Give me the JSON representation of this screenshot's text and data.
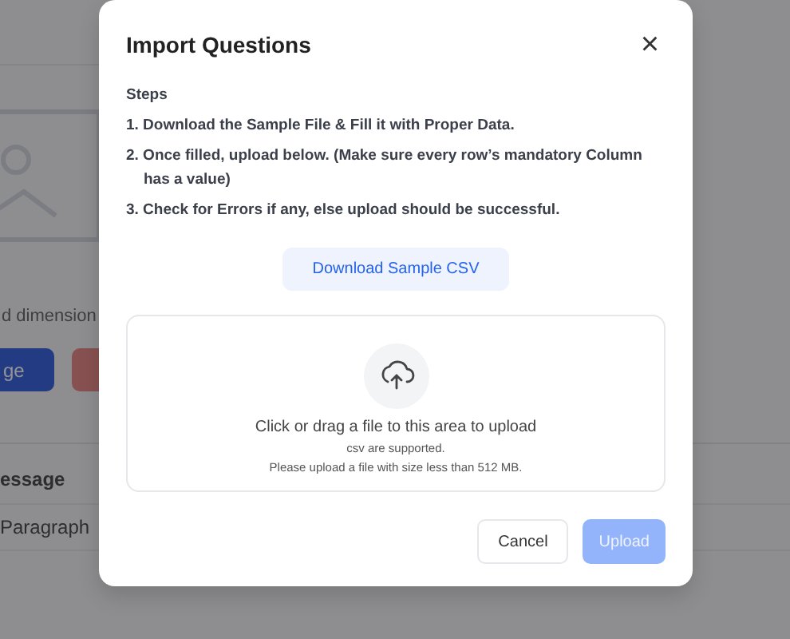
{
  "background": {
    "caption": "d dimension",
    "primary_button": "ge",
    "table": {
      "column_1": "essage",
      "rows": [
        "Paragraph"
      ]
    }
  },
  "dialog": {
    "title": "Import Questions",
    "close": "×",
    "steps_heading": "Steps",
    "steps": [
      "1. Download the Sample File & Fill it with Proper Data.",
      "2. Once filled, upload below. (Make sure every row’s mandatory Column has a value)",
      "3. Check for Errors if any, else upload should be successful."
    ],
    "download_button": "Download Sample CSV",
    "dropzone": {
      "title": "Click or drag a file to this area to upload",
      "hint": "csv are supported.",
      "limit": "Please upload a file with size less than 512 MB."
    },
    "buttons": [
      {
        "label": "Cancel",
        "kind": "secondary",
        "disabled": false
      },
      {
        "label": "Upload",
        "kind": "primary",
        "disabled": true
      }
    ]
  }
}
